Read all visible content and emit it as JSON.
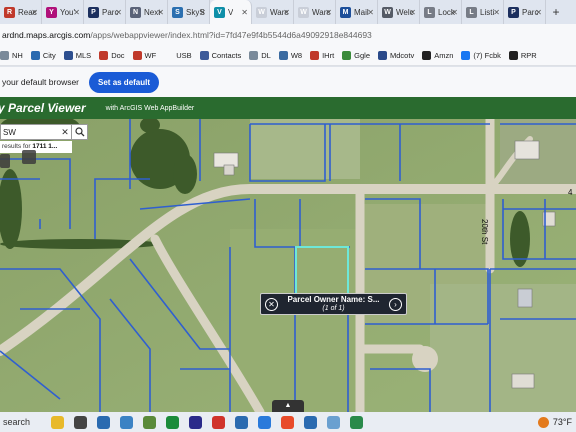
{
  "browser": {
    "tabs": [
      {
        "label": "Reac",
        "fav_color": "#c0392b",
        "fav_glyph": "R"
      },
      {
        "label": "You'",
        "fav_color": "#b0107a",
        "fav_glyph": "Y"
      },
      {
        "label": "Parc",
        "fav_color": "#1c2f5e",
        "fav_glyph": "P"
      },
      {
        "label": "Next",
        "fav_color": "#5a6378",
        "fav_glyph": "N"
      },
      {
        "label": "SkyS",
        "fav_color": "#2b6fb0",
        "fav_glyph": "S"
      },
      {
        "label": "V",
        "fav_color": "#0e8fa8",
        "fav_glyph": "V",
        "active": true
      },
      {
        "label": "Warc",
        "fav_color": "#c9ced8",
        "fav_glyph": "W"
      },
      {
        "label": "Warc",
        "fav_color": "#c9ced8",
        "fav_glyph": "W"
      },
      {
        "label": "Mail",
        "fav_color": "#1d4f9a",
        "fav_glyph": "M"
      },
      {
        "label": "Welc",
        "fav_color": "#555b66",
        "fav_glyph": "W"
      },
      {
        "label": "Lock",
        "fav_color": "#777c86",
        "fav_glyph": "L"
      },
      {
        "label": "Listi",
        "fav_color": "#777c86",
        "fav_glyph": "L"
      },
      {
        "label": "Parc",
        "fav_color": "#1c2f5e",
        "fav_glyph": "P"
      }
    ],
    "new_tab_label": "+",
    "url_host": "ardnd.maps.arcgis.com",
    "url_path": "/apps/webappviewer/index.html?id=7fd47e9f4b5544d6a49092918e844693",
    "bookmarks": [
      {
        "label": "NH",
        "color": "#7a8a9a"
      },
      {
        "label": "City",
        "color": "#2a6ab0"
      },
      {
        "label": "MLS",
        "color": "#2d4f8f"
      },
      {
        "label": "Doc",
        "color": "#c0392b"
      },
      {
        "label": "WF",
        "color": "#c0392b"
      },
      {
        "label": "USB",
        "color": "#f7f8fa"
      },
      {
        "label": "Contacts",
        "color": "#3c5a9a"
      },
      {
        "label": "DL",
        "color": "#7a8a9a"
      },
      {
        "label": "W8",
        "color": "#3a6aa0"
      },
      {
        "label": "IHrt",
        "color": "#c0392b"
      },
      {
        "label": "Ggle",
        "color": "#3a8a3a"
      },
      {
        "label": "Mdcotv",
        "color": "#2a4a8a"
      },
      {
        "label": "Amzn",
        "color": "#222222"
      },
      {
        "label": "(7) Fcbk",
        "color": "#1877f2"
      },
      {
        "label": "RPR",
        "color": "#222222"
      }
    ],
    "infobar_message": "your default browser",
    "infobar_button": "Set as default"
  },
  "app": {
    "title": "y Parcel Viewer",
    "subtitle": "with ArcGIS Web AppBuilder",
    "header_color": "#2a6b2f"
  },
  "search": {
    "value": "SW",
    "clear_icon": "close-icon",
    "search_icon": "search-icon",
    "results_prefix": "results for",
    "results_query": "1711 1..."
  },
  "map": {
    "street_label": "20th St",
    "street_label_partial": "4"
  },
  "popup": {
    "title": "Parcel Owner Name: S...",
    "count": "(1 of 1)"
  },
  "taskbar": {
    "search_label": "search",
    "temperature": "73°F",
    "icons": [
      "#e8b92a",
      "#444444",
      "#2a6ab0",
      "#3b82c4",
      "#5a8a3a",
      "#1b8b3a",
      "#2a2a8a",
      "#d0332b",
      "#2a6ab0",
      "#2a7adb",
      "#e84a2a",
      "#2a6ab0",
      "#6aa0d0",
      "#2a8a4a"
    ]
  }
}
